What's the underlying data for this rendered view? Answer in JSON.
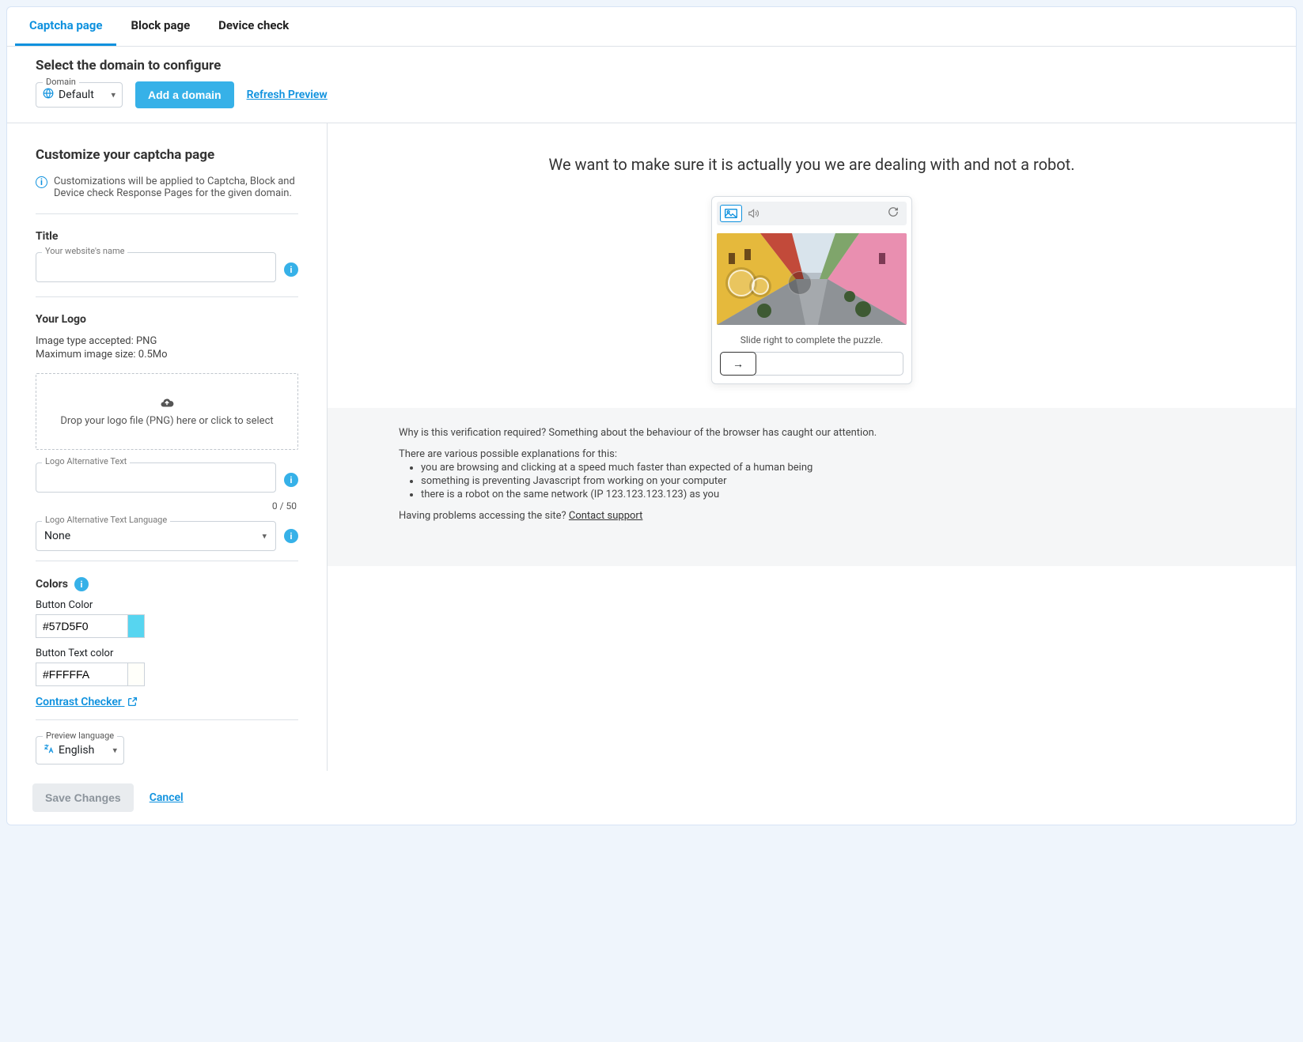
{
  "tabs": {
    "captcha": "Captcha page",
    "block": "Block page",
    "device": "Device check"
  },
  "domain_bar": {
    "title": "Select the domain to configure",
    "domain_label": "Domain",
    "domain_value": "Default",
    "add_domain": "Add a domain",
    "refresh": "Refresh Preview"
  },
  "customize": {
    "heading": "Customize your captcha page",
    "info": "Customizations will be applied to Captcha, Block and Device check Response Pages for the given domain.",
    "title_section": "Title",
    "title_label": "Your website's name",
    "logo_section": "Your Logo",
    "logo_type": "Image type accepted: PNG",
    "logo_size": "Maximum image size: 0.5Mo",
    "dropzone": "Drop your logo file (PNG) here or click to select",
    "alt_label": "Logo Alternative Text",
    "alt_counter": "0 / 50",
    "alt_lang_label": "Logo Alternative Text Language",
    "alt_lang_value": "None",
    "colors_section": "Colors",
    "button_color_label": "Button Color",
    "button_color_value": "#57D5F0",
    "button_text_color_label": "Button Text color",
    "button_text_color_value": "#FFFFFA",
    "contrast_checker": "Contrast Checker",
    "preview_lang_label": "Preview language",
    "preview_lang_value": "English"
  },
  "footer": {
    "save": "Save Changes",
    "cancel": "Cancel"
  },
  "preview": {
    "hero": "We want to make sure it is actually you we are dealing with and not a robot.",
    "slide_label": "Slide right to complete the puzzle.",
    "explain_intro": "Why is this verification required? Something about the behaviour of the browser has caught our attention.",
    "explain_lead": "There are various possible explanations for this:",
    "reason1": "you are browsing and clicking at a speed much faster than expected of a human being",
    "reason2": "something is preventing Javascript from working on your computer",
    "reason3": "there is a robot on the same network (IP 123.123.123.123) as you",
    "problems": "Having problems accessing the site? ",
    "contact": "Contact support"
  },
  "colors": {
    "button": "#57D5F0",
    "button_text": "#FFFFFA"
  }
}
